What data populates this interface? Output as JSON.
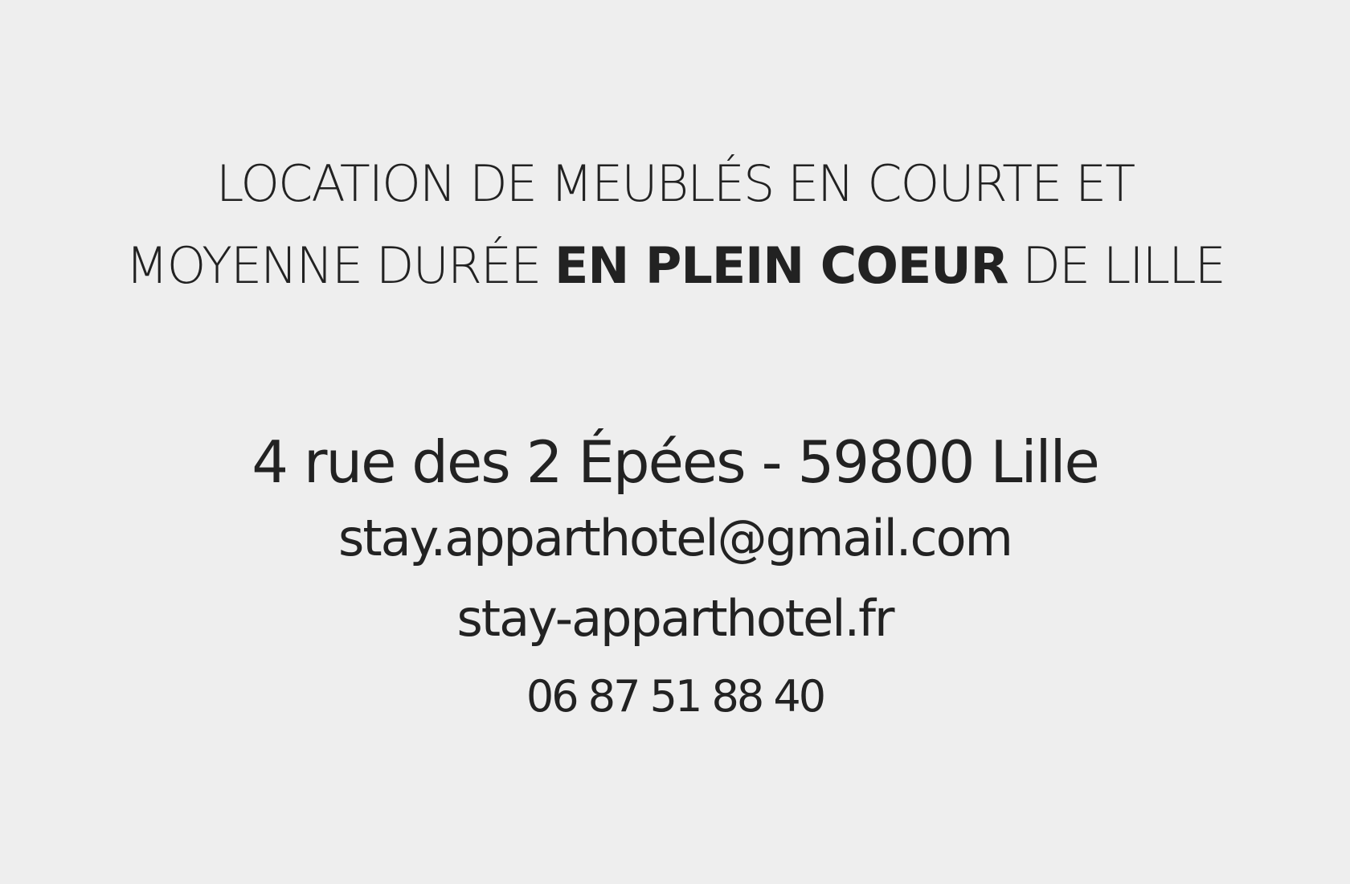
{
  "headline": {
    "line1": "LOCATION DE MEUBLÉS EN COURTE ET",
    "line2_before": "MOYENNE DURÉE ",
    "line2_emphasis": "EN PLEIN COEUR",
    "line2_after": " DE LILLE"
  },
  "contact": {
    "address": "4 rue des 2 Épées - 59800 Lille",
    "email": "stay.apparthotel@gmail.com",
    "website": "stay-apparthotel.fr",
    "phone": "06 87 51 88 40"
  },
  "colors": {
    "background": "#eeeeee",
    "text": "#222222"
  }
}
